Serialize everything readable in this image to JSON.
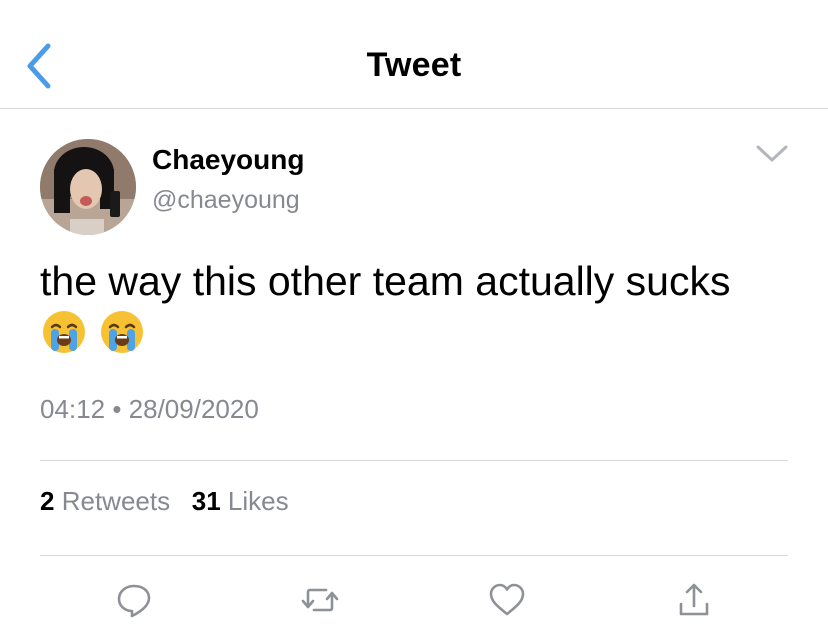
{
  "header": {
    "title": "Tweet"
  },
  "tweet": {
    "author_name": "Chaeyoung",
    "author_handle": "@chaeyoung",
    "text": "the way this other team actually sucks",
    "time": "04:12",
    "separator": "•",
    "date": "28/09/2020",
    "retweets_count": "2",
    "retweets_label": "Retweets",
    "likes_count": "31",
    "likes_label": "Likes"
  },
  "colors": {
    "accent": "#4a9bea",
    "muted": "#86898f",
    "divider": "#d6d6d6"
  },
  "icons": {
    "back": "chevron-left-icon",
    "more": "chevron-down-icon",
    "reply": "reply-icon",
    "retweet": "retweet-icon",
    "like": "heart-icon",
    "share": "share-icon",
    "emoji": "loudly-crying-face"
  }
}
